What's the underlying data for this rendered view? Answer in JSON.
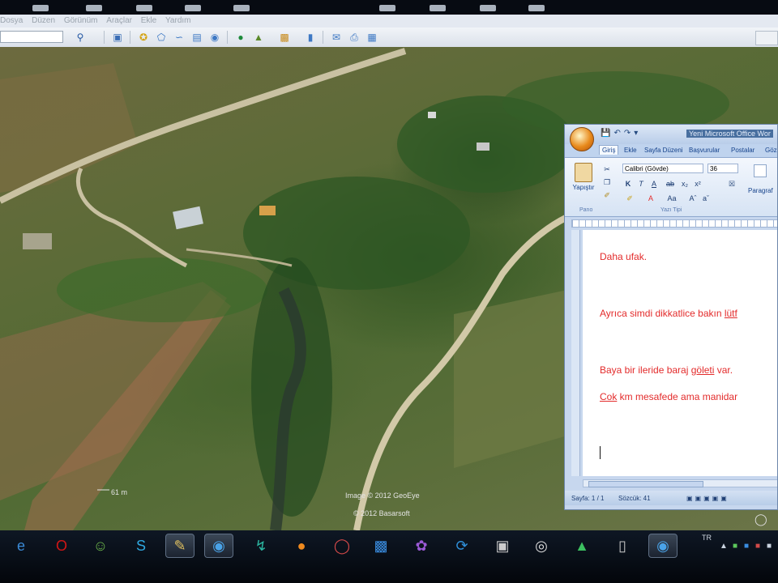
{
  "menu": {
    "items": [
      "Dosya",
      "Düzen",
      "Görünüm",
      "Araçlar",
      "Ekle",
      "Yardım"
    ]
  },
  "toolbar": {
    "search_placeholder": "",
    "search_icon": "search-icon",
    "buttons": [
      "sidebar-icon",
      "placemark-icon",
      "polygon-icon",
      "path-icon",
      "image-overlay-icon",
      "record-tour-icon",
      "earth-icon",
      "sun-icon",
      "planets-icon",
      "ruler-icon",
      "email-icon",
      "print-icon",
      "maps-icon"
    ]
  },
  "map": {
    "scale_label": "61 m",
    "credit_line1": "Image © 2012 GeoEye",
    "credit_line2": "© 2012 Basarsoft",
    "road_color": "#c9c1a2",
    "vegetation_color": "#2f5a26"
  },
  "word": {
    "title": "Yeni Microsoft Office Wor",
    "ribbon_tabs": [
      "Giriş",
      "Ekle",
      "Sayfa Düzeni",
      "Başvurular",
      "Postalar",
      "Gözden"
    ],
    "active_tab": "Giriş",
    "paste_label": "Yapıştır",
    "clipboard_group": "Pano",
    "font_group": "Yazı Tipi",
    "font_name": "Calibri (Gövde)",
    "font_size": "36",
    "paragraph_label": "Paragraf",
    "doc_lines": [
      {
        "text": "Daha ufak.",
        "underlined": ""
      },
      {
        "text": "Ayrıca simdi dikkatlice bakın ",
        "underlined": "lütf"
      },
      {
        "text": "Baya bir ileride baraj ",
        "underlined": "göleti",
        "after": " var."
      },
      {
        "text": " km mesafede  ama manidar",
        "underlined_before": "Cok"
      }
    ],
    "status_page": "Sayfa: 1 / 1",
    "status_words": "Sözcük: 41",
    "text_color": "#e32b2b"
  },
  "taskbar": {
    "icons": [
      "internet-explorer-icon",
      "opera-icon",
      "messenger-icon",
      "skype-icon",
      "tool-icon",
      "google-earth-active-icon",
      "media-icon",
      "orange-app-icon",
      "record-icon",
      "teamviewer-icon",
      "spiral-icon",
      "sync-icon",
      "camera-icon",
      "chrome-icon",
      "triangle-app-icon",
      "phone-icon",
      "google-earth-icon"
    ],
    "tray_lang": "TR"
  }
}
